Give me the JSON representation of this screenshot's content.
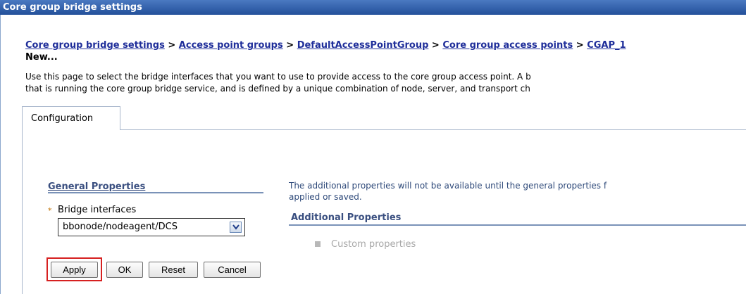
{
  "window": {
    "title": "Core group bridge settings"
  },
  "breadcrumb": {
    "items": [
      "Core group bridge settings",
      "Access point groups",
      "DefaultAccessPointGroup",
      "Core group access points",
      "CGAP_1"
    ],
    "separator": ">",
    "current": "New..."
  },
  "description": {
    "line1": "Use this page to select the bridge interfaces that you want to use to provide access to the core group access point. A b",
    "line2": "that is running the core group bridge service, and is defined by a unique combination of node, server, and transport ch"
  },
  "tabs": [
    {
      "label": "Configuration"
    }
  ],
  "general_properties": {
    "title": "General Properties",
    "required_marker": "*",
    "bridge_interfaces_label": "Bridge interfaces",
    "bridge_interfaces_value": "bbonode/nodeagent/DCS"
  },
  "buttons": {
    "apply": "Apply",
    "ok": "OK",
    "reset": "Reset",
    "cancel": "Cancel"
  },
  "additional": {
    "note_line1": "The additional properties will not be available until the general properties f",
    "note_line2": "applied or saved.",
    "title": "Additional Properties",
    "items": [
      {
        "label": "Custom properties"
      }
    ]
  },
  "colors": {
    "titlebar": "#2f5ea8",
    "link": "#1f2e9a",
    "highlight": "#d62020"
  }
}
